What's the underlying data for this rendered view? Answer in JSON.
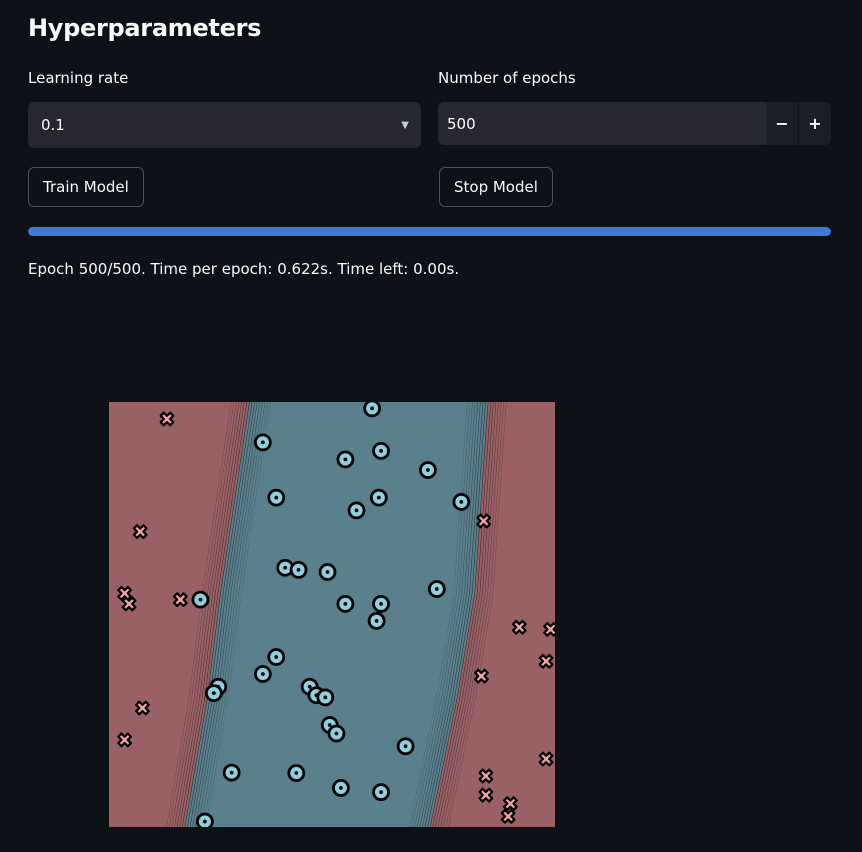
{
  "header": {
    "title": "Hyperparameters"
  },
  "learning_rate": {
    "label": "Learning rate",
    "value": "0.1"
  },
  "epochs": {
    "label": "Number of epochs",
    "value": "500",
    "decrement": "−",
    "increment": "+"
  },
  "buttons": {
    "train": "Train Model",
    "stop": "Stop Model"
  },
  "progress": {
    "fraction": 1.0,
    "color": "#3f7bd6"
  },
  "status": {
    "text": "Epoch 500/500. Time per epoch: 0.622s. Time left: 0.00s."
  },
  "plot": {
    "type": "scatter",
    "colors": {
      "class_x_region": "#9a6165",
      "class_o_region": "#5a808d",
      "x_marker": "#f2a49e",
      "o_marker": "#8fd0dc",
      "edge": "#000000"
    },
    "xlim": [
      0,
      1
    ],
    "ylim": [
      0,
      1
    ],
    "boundary_left": [
      [
        0.315,
        1.0
      ],
      [
        0.25,
        0.55
      ],
      [
        0.22,
        0.3
      ],
      [
        0.17,
        0.0
      ]
    ],
    "boundary_right": [
      [
        0.85,
        1.0
      ],
      [
        0.82,
        0.55
      ],
      [
        0.78,
        0.3
      ],
      [
        0.72,
        0.0
      ]
    ],
    "points_x": [
      [
        0.13,
        0.96
      ],
      [
        0.07,
        0.695
      ],
      [
        0.035,
        0.55
      ],
      [
        0.045,
        0.525
      ],
      [
        0.16,
        0.535
      ],
      [
        0.84,
        0.72
      ],
      [
        0.92,
        0.47
      ],
      [
        0.99,
        0.465
      ],
      [
        0.98,
        0.39
      ],
      [
        0.835,
        0.355
      ],
      [
        0.075,
        0.28
      ],
      [
        0.035,
        0.205
      ],
      [
        0.98,
        0.16
      ],
      [
        0.845,
        0.12
      ],
      [
        0.845,
        0.075
      ],
      [
        0.9,
        0.055
      ],
      [
        0.895,
        0.025
      ]
    ],
    "points_o": [
      [
        0.59,
        0.985
      ],
      [
        0.345,
        0.905
      ],
      [
        0.61,
        0.885
      ],
      [
        0.53,
        0.865
      ],
      [
        0.715,
        0.84
      ],
      [
        0.375,
        0.775
      ],
      [
        0.605,
        0.775
      ],
      [
        0.555,
        0.745
      ],
      [
        0.79,
        0.765
      ],
      [
        0.395,
        0.61
      ],
      [
        0.425,
        0.605
      ],
      [
        0.49,
        0.6
      ],
      [
        0.735,
        0.56
      ],
      [
        0.205,
        0.535
      ],
      [
        0.53,
        0.525
      ],
      [
        0.61,
        0.525
      ],
      [
        0.6,
        0.485
      ],
      [
        0.375,
        0.4
      ],
      [
        0.345,
        0.36
      ],
      [
        0.245,
        0.33
      ],
      [
        0.235,
        0.315
      ],
      [
        0.45,
        0.33
      ],
      [
        0.465,
        0.31
      ],
      [
        0.485,
        0.305
      ],
      [
        0.495,
        0.24
      ],
      [
        0.51,
        0.22
      ],
      [
        0.665,
        0.19
      ],
      [
        0.275,
        0.128
      ],
      [
        0.42,
        0.127
      ],
      [
        0.52,
        0.092
      ],
      [
        0.61,
        0.082
      ],
      [
        0.215,
        0.013
      ]
    ]
  }
}
